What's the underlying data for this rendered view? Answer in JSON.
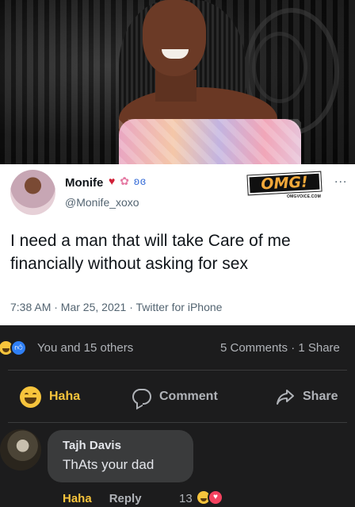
{
  "tweet": {
    "name": "Monife",
    "handle": "@Monife_xoxo",
    "emoji_heart": "♥",
    "emoji_flower": "✿",
    "emoji_butterfly": "ʚɞ",
    "watermark": "OMG!",
    "watermark_site": "OMGVOICE.COM",
    "more": "...",
    "text": "I need a man that will take Care of me financially without asking for sex",
    "meta": "7:38 AM · Mar 25, 2021 · Twitter for iPhone"
  },
  "post": {
    "reactions_label": "You and 15 others",
    "counts": "5 Comments · 1 Share",
    "reaction_icons": [
      "haha-icon",
      "like-icon"
    ]
  },
  "actions": {
    "haha": "Haha",
    "comment": "Comment",
    "share": "Share"
  },
  "comment": {
    "author": "Tajh Davis",
    "text": "ThAts your dad",
    "haha_link": "Haha",
    "reply_link": "Reply",
    "reaction_count": "13"
  },
  "colors": {
    "background": "#1c1c1d",
    "haha_yellow": "#f7c43c",
    "like_blue": "#2f7ff4",
    "love_pink": "#f3425f",
    "comment_bubble": "#3a3b3c"
  }
}
